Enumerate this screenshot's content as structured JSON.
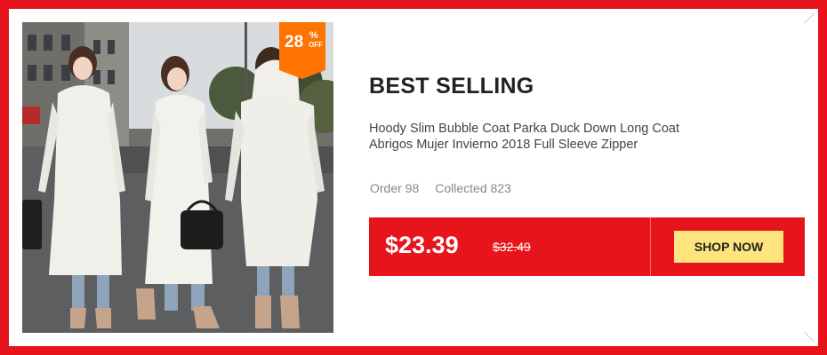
{
  "badge": {
    "number": "28",
    "percent": "%",
    "off": "OFF",
    "color": "#ff7300"
  },
  "product": {
    "heading": "BEST SELLING",
    "description": "Hoody Slim Bubble Coat Parka Duck Down Long Coat Abrigos Mujer Invierno 2018 Full Sleeve Zipper",
    "orders_label": "Order 98",
    "collected_label": "Collected 823",
    "price": "$23.39",
    "old_price": "$32.49",
    "button_label": "SHOP NOW"
  },
  "colors": {
    "frame": "#e8141b",
    "price_bar": "#e8141b",
    "button": "#fde47e"
  },
  "image": {
    "subject": "three women wearing long white hooded down coats on a city street"
  }
}
